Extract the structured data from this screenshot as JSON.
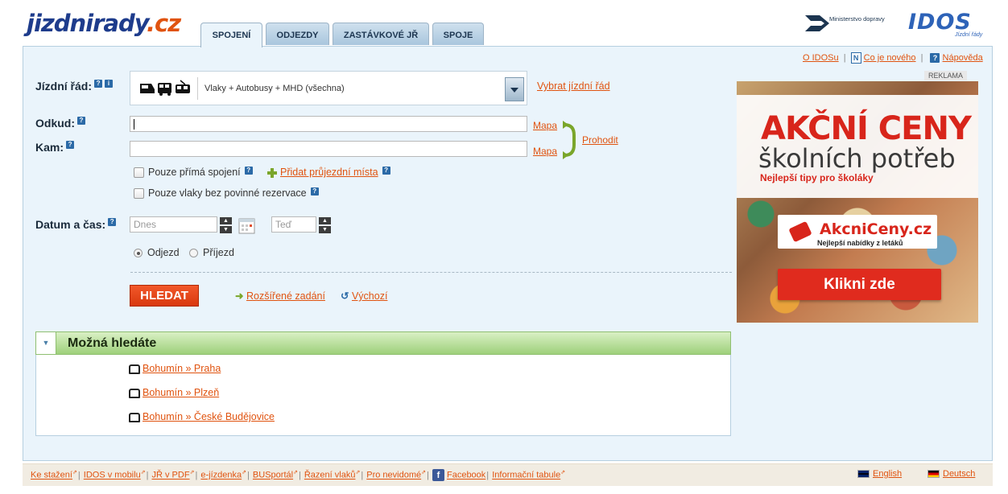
{
  "header": {
    "logo": {
      "main": "jizdnirady",
      "tld": ".cz"
    },
    "tabs": [
      {
        "label": "SPOJENÍ",
        "active": true
      },
      {
        "label": "ODJEZDY",
        "active": false
      },
      {
        "label": "ZASTÁVKOVÉ JŘ",
        "active": false
      },
      {
        "label": "SPOJE",
        "active": false
      }
    ],
    "ministry": "Ministerstvo dopravy",
    "idos": "IDOS",
    "idos_sub": "Jízdní řády"
  },
  "toplinks": [
    "O IDOSu",
    "Co je nového",
    "Nápověda"
  ],
  "form": {
    "timetable_label": "Jízdní řád:",
    "timetable_value": "Vlaky + Autobusy + MHD (všechna)",
    "choose_timetable": "Vybrat jízdní řád",
    "from_label": "Odkud:",
    "to_label": "Kam:",
    "map_link": "Mapa",
    "swap_link": "Prohodit",
    "direct_only": "Pouze přímá spojení",
    "add_via": "Přidat průjezdní místa",
    "no_reservation": "Pouze vlaky bez povinné rezervace",
    "datetime_label": "Datum a čas:",
    "date_placeholder": "Dnes",
    "time_placeholder": "Teď",
    "departure": "Odjezd",
    "arrival": "Příjezd",
    "search_button": "HLEDAT",
    "advanced": "Rozšířené zadání",
    "default": "Výchozí"
  },
  "suggestions": {
    "title": "Možná hledáte",
    "items": [
      "Bohumín » Praha",
      "Bohumín » Plzeň",
      "Bohumín » České Budějovice"
    ]
  },
  "ad": {
    "label": "REKLAMA",
    "headline": "AKČNÍ CENY",
    "subheadline": "školních potřeb",
    "tagline": "Nejlepší tipy pro školáky",
    "logo": "AkcniCeny.cz",
    "logo_sub": "Nejlepší nabídky z letáků",
    "button": "Klikni zde"
  },
  "footer": {
    "links": [
      "Ke stažení",
      "IDOS v mobilu",
      "JŘ v PDF",
      "e-jízdenka",
      "BUSportál",
      "Řazení vlaků",
      "Pro nevidomé",
      "Facebook",
      "Informační tabule"
    ],
    "lang_en": "English",
    "lang_de": "Deutsch"
  },
  "colors": {
    "accent": "#e0530f",
    "brand": "#1e3c8c",
    "panel": "#eaf4fb",
    "suggest_green": "#9ed07b"
  }
}
